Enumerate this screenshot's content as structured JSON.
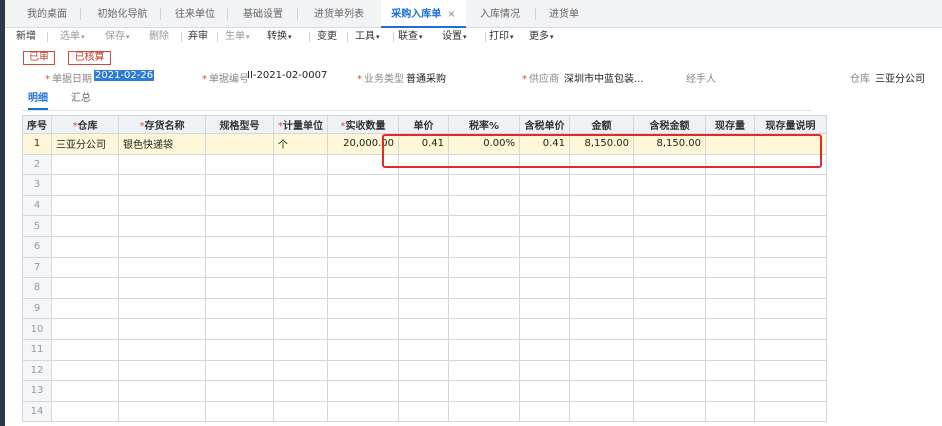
{
  "tabs": [
    {
      "label": "我的桌面"
    },
    {
      "label": "初始化导航"
    },
    {
      "label": "往来单位"
    },
    {
      "label": "基础设置"
    },
    {
      "label": "进货单列表"
    },
    {
      "label": "采购入库单",
      "close": "×"
    },
    {
      "label": "入库情况"
    },
    {
      "label": "进货单"
    }
  ],
  "toolbar": {
    "new": "新增",
    "select_doc": "选单",
    "save": "保存",
    "delete": "删除",
    "abandon": "弃审",
    "generate": "生单",
    "convert": "转换",
    "change": "变更",
    "tools": "工具",
    "link_query": "联查",
    "settings": "设置",
    "print": "打印",
    "more": "更多",
    "caret": "▾"
  },
  "status": {
    "audited": "已审",
    "checked": "已核算"
  },
  "header": {
    "date_label": "单据日期",
    "date_value": "2021-02-26",
    "number_label": "单据编号",
    "number_value": "II-2021-02-0007",
    "biz_type_label": "业务类型",
    "biz_type_value": "普通采购",
    "supplier_label": "供应商",
    "supplier_value": "深圳市中蓝包装...",
    "handler_label": "经手人",
    "warehouse_label": "仓库",
    "warehouse_value": "三亚分公司"
  },
  "subtabs": {
    "detail": "明细",
    "summary": "汇总"
  },
  "grid": {
    "columns": [
      "序号",
      "仓库",
      "存货名称",
      "规格型号",
      "计量单位",
      "实收数量",
      "单价",
      "税率%",
      "含税单价",
      "金额",
      "含税金额",
      "现存量",
      "现存量说明"
    ],
    "rows": [
      {
        "idx": "1",
        "warehouse": "三亚分公司",
        "item": "银色快递袋",
        "spec": "",
        "unit": "个",
        "qty": "20,000.00",
        "price": "0.41",
        "tax_rate": "0.00%",
        "tax_price": "0.41",
        "amount": "8,150.00",
        "tax_amount": "8,150.00",
        "stock": "",
        "stock_note": ""
      }
    ],
    "empty_rows": [
      "2",
      "3",
      "4",
      "5",
      "6",
      "7",
      "8",
      "9",
      "10",
      "11",
      "12",
      "13",
      "14"
    ]
  },
  "colors": {
    "accent": "#1d6fd6",
    "stamp": "#c23a2a",
    "highlight": "#e02b2b",
    "row_selected": "#fdf6d7"
  }
}
